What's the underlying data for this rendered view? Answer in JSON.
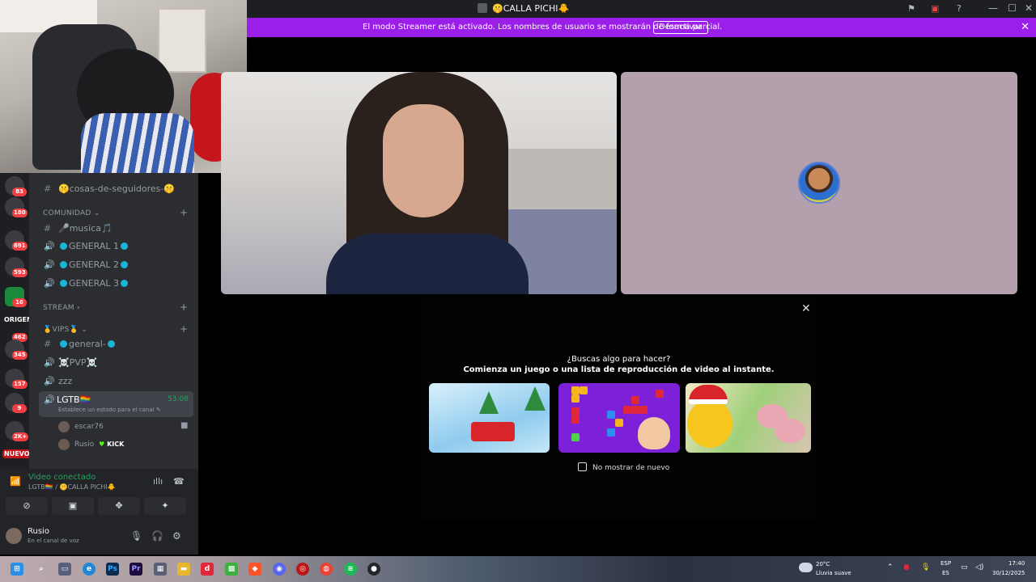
{
  "window": {
    "title": "🤫CALLA PICHI🐥",
    "controls": {
      "minimize": "—",
      "maximize": "☐",
      "close": "✕"
    }
  },
  "banner": {
    "message": "El modo Streamer está activado. Los nombres de usuario se mostrarán de forma parcial.",
    "button": "Desactivar",
    "close": "✕",
    "color": "#9b1fe8"
  },
  "rail": {
    "badges": [
      "83",
      "180",
      "691",
      "593",
      "16",
      "462",
      "345",
      "157",
      "9",
      "2K+"
    ],
    "labels": {
      "origen": "ORIGEN",
      "nuevo": "NUEVO"
    }
  },
  "sidebar": {
    "channels_top": [
      {
        "symbol": "#",
        "label": "🤫cosas-de-seguidores-🤫"
      }
    ],
    "category_comunidad": "COMUNIDAD",
    "comunidad": [
      {
        "symbol": "#",
        "label": "🎤musica🎵"
      },
      {
        "symbol": "🔊",
        "label": "GENERAL 1"
      },
      {
        "symbol": "🔊",
        "label": "GENERAL 2"
      },
      {
        "symbol": "🔊",
        "label": "GENERAL 3"
      }
    ],
    "category_stream": "STREAM",
    "category_vips": "🥇VIPS🥇",
    "vips": [
      {
        "symbol": "#",
        "label": "general-"
      },
      {
        "symbol": "🔊",
        "label": "☠️PVP☠️"
      },
      {
        "symbol": "🔊",
        "label": "zzz"
      }
    ],
    "active_channel": {
      "name": "LGTB🏳️‍🌈",
      "time": "53:08",
      "status": "Establece un estado para el canal"
    },
    "members": [
      {
        "name": "escar76"
      },
      {
        "name": "Rusio",
        "tag": "KICK"
      }
    ]
  },
  "voice": {
    "title": "Video conectado",
    "subtitle": "LGTB🏳️‍🌈 / 🤫CALLA PICHI🐥",
    "buttons": [
      "camera-off",
      "screen-share",
      "activities",
      "soundboard"
    ]
  },
  "user": {
    "name": "Rusio",
    "status": "En el canal de voz"
  },
  "modal": {
    "close": "✕",
    "heading": "¿Buscas algo para hacer?",
    "subheading": "Comienza un juego o una lista de reproducción de video al instante.",
    "checkbox_label": "No mostrar de nuevo",
    "games": [
      "snow-truck-game",
      "block-puzzle-game",
      "chick-christmas-game"
    ]
  },
  "taskbar": {
    "weather_temp": "20°C",
    "weather_desc": "Lluvia suave",
    "lang": "ESP",
    "lang_region": "ES",
    "time": "17:40",
    "date": "30/12/2025"
  }
}
